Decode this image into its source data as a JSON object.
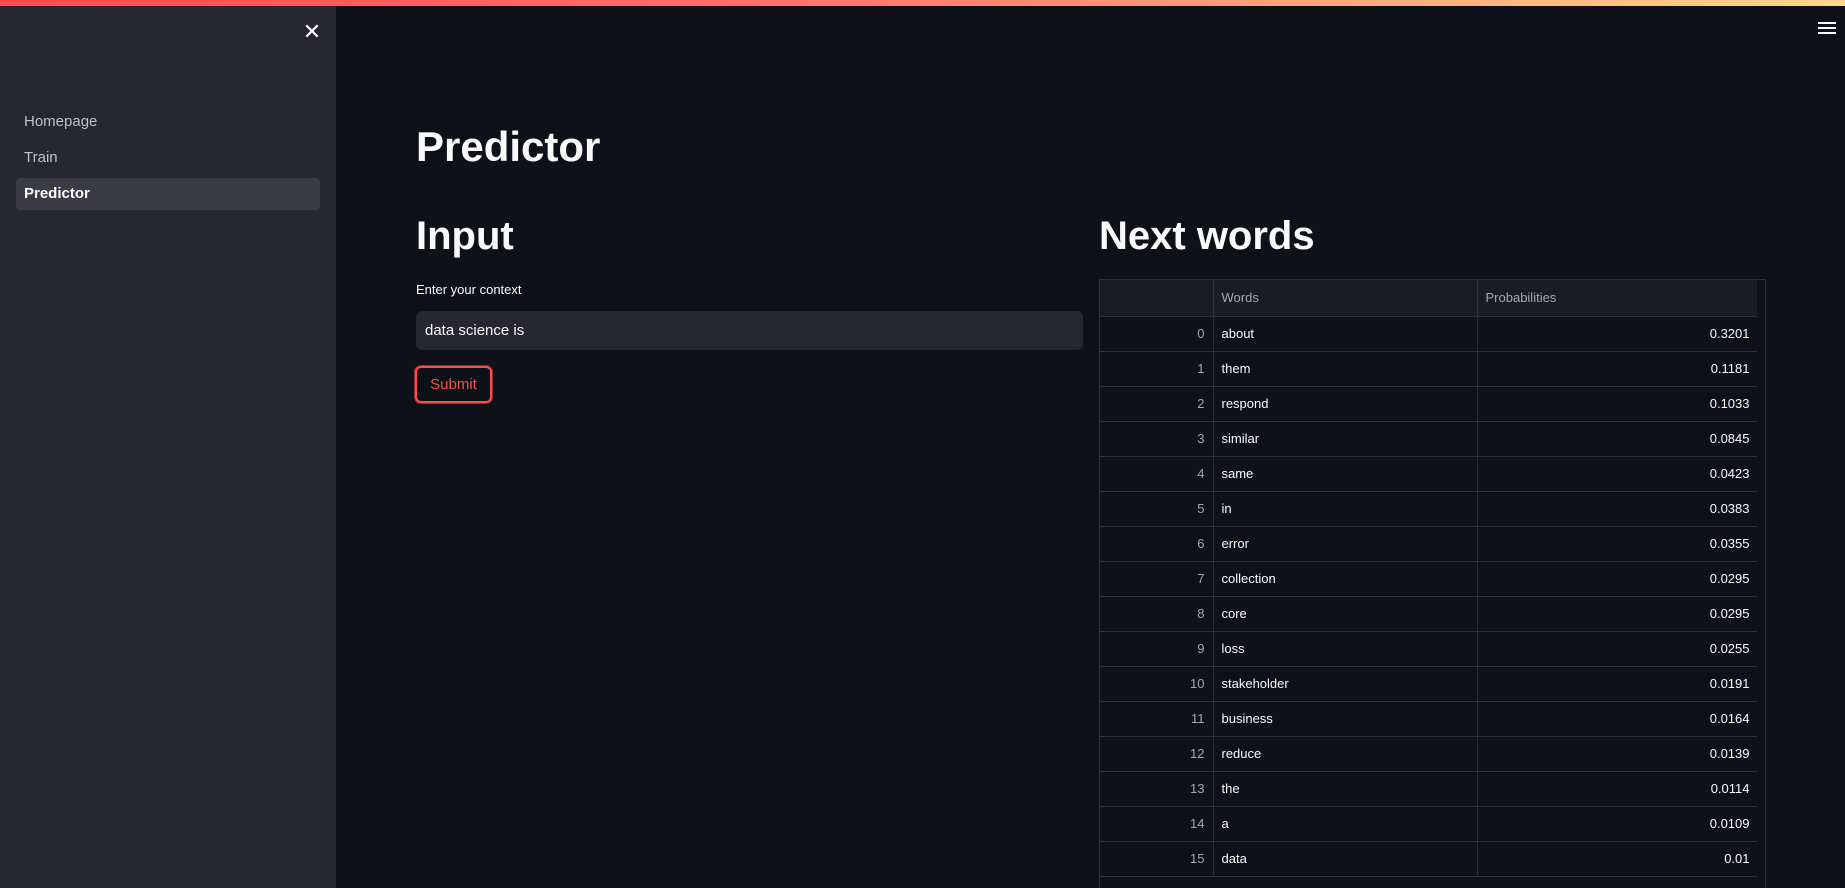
{
  "sidebar": {
    "nav": [
      {
        "label": "Homepage"
      },
      {
        "label": "Train"
      },
      {
        "label": "Predictor"
      }
    ],
    "active": "Predictor"
  },
  "main": {
    "title": "Predictor",
    "input_section": {
      "heading": "Input",
      "label": "Enter your context",
      "value": "data science is",
      "submit_label": "Submit"
    },
    "output_section": {
      "heading": "Next words",
      "columns": [
        "",
        "Words",
        "Probabilities"
      ],
      "rows": [
        {
          "index": "0",
          "word": "about",
          "prob": "0.3201"
        },
        {
          "index": "1",
          "word": "them",
          "prob": "0.1181"
        },
        {
          "index": "2",
          "word": "respond",
          "prob": "0.1033"
        },
        {
          "index": "3",
          "word": "similar",
          "prob": "0.0845"
        },
        {
          "index": "4",
          "word": "same",
          "prob": "0.0423"
        },
        {
          "index": "5",
          "word": "in",
          "prob": "0.0383"
        },
        {
          "index": "6",
          "word": "error",
          "prob": "0.0355"
        },
        {
          "index": "7",
          "word": "collection",
          "prob": "0.0295"
        },
        {
          "index": "8",
          "word": "core",
          "prob": "0.0295"
        },
        {
          "index": "9",
          "word": "loss",
          "prob": "0.0255"
        },
        {
          "index": "10",
          "word": "stakeholder",
          "prob": "0.0191"
        },
        {
          "index": "11",
          "word": "business",
          "prob": "0.0164"
        },
        {
          "index": "12",
          "word": "reduce",
          "prob": "0.0139"
        },
        {
          "index": "13",
          "word": "the",
          "prob": "0.0114"
        },
        {
          "index": "14",
          "word": "a",
          "prob": "0.0109"
        },
        {
          "index": "15",
          "word": "data",
          "prob": "0.01"
        }
      ]
    }
  },
  "icons": {
    "close": "close-icon",
    "menu": "hamburger-menu-icon"
  },
  "colors": {
    "background": "#0e1117",
    "sidebar": "#262730",
    "accent": "#ff4b4b"
  }
}
